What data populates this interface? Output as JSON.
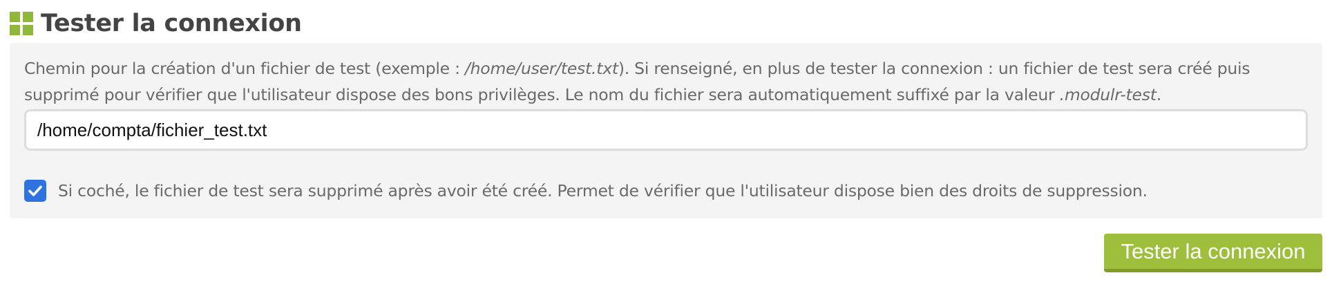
{
  "section": {
    "title": "Tester la connexion",
    "icon": "grid-icon",
    "accent_color": "#8fb73a"
  },
  "test_file": {
    "description_part1": "Chemin pour la création d'un fichier de test (exemple : ",
    "example_path": "/home/user/test.txt",
    "description_part2": "). Si renseigné, en plus de tester la connexion : un fichier de test sera créé puis supprimé pour vérifier que l'utilisateur dispose des bons privilèges. Le nom du fichier sera automatiquement suffixé par la valeur ",
    "suffix": ".modulr-test",
    "description_part3": ".",
    "path_value": "/home/compta/fichier_test.txt"
  },
  "delete_option": {
    "checked": true,
    "label": "Si coché, le fichier de test sera supprimé après avoir été créé. Permet de vérifier que l'utilisateur dispose bien des droits de suppression.",
    "checkbox_color": "#2f73e0"
  },
  "actions": {
    "test_button_label": "Tester la connexion",
    "button_color": "#9dbf3c"
  }
}
